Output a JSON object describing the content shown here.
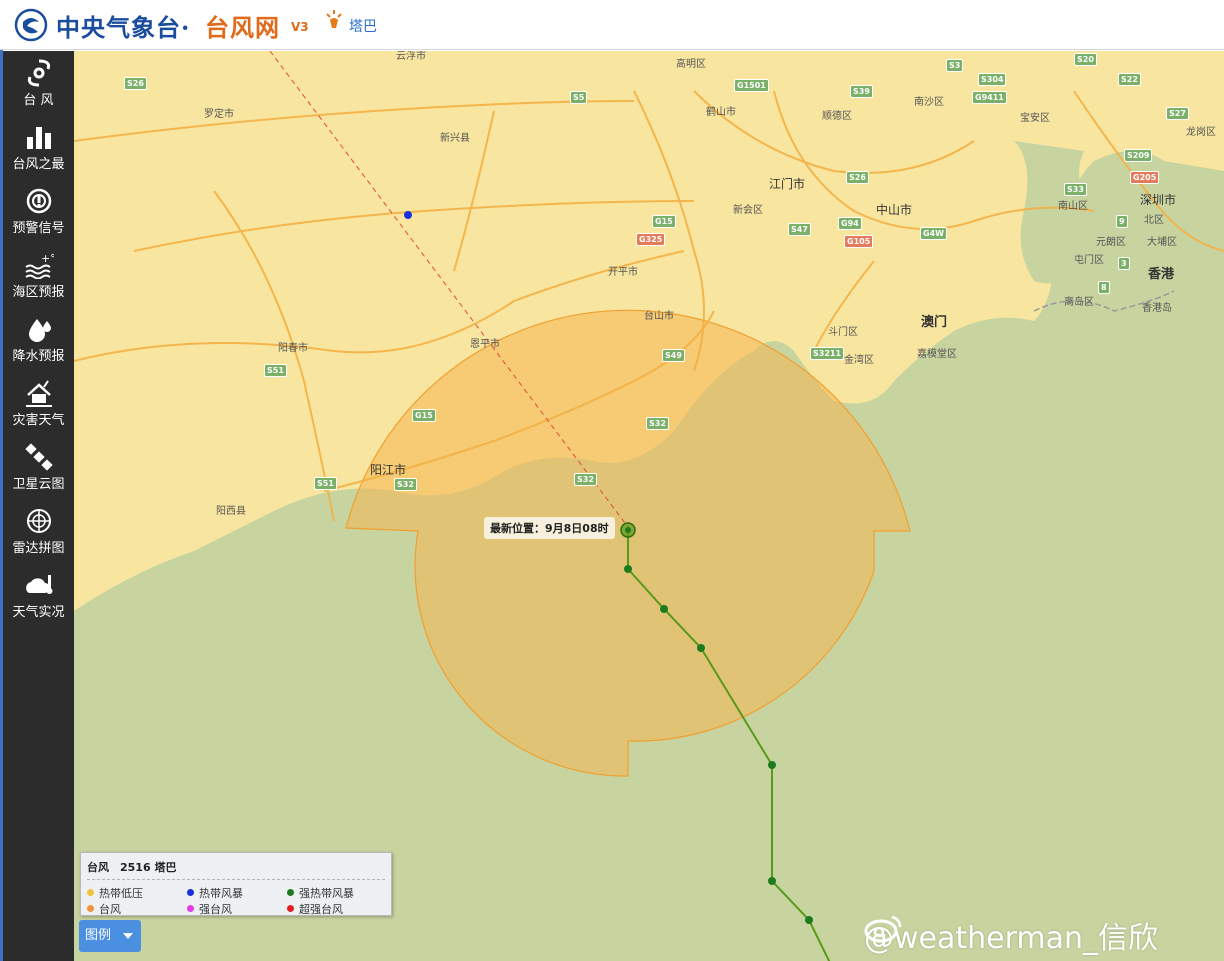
{
  "header": {
    "title_main": "中央气象台·",
    "title_site": "台风网",
    "version": "V3",
    "storm_name": "塔巴"
  },
  "sidebar": {
    "items": [
      {
        "label": "台 风",
        "icon": "typhoon-icon"
      },
      {
        "label": "台风之最",
        "icon": "bar-chart-icon"
      },
      {
        "label": "预警信号",
        "icon": "warning-signal-icon"
      },
      {
        "label": "海区预报",
        "icon": "sea-forecast-icon"
      },
      {
        "label": "降水预报",
        "icon": "rain-drop-icon"
      },
      {
        "label": "灾害天气",
        "icon": "disaster-house-icon"
      },
      {
        "label": "卫星云图",
        "icon": "satellite-icon"
      },
      {
        "label": "雷达拼图",
        "icon": "radar-icon"
      },
      {
        "label": "天气实况",
        "icon": "weather-cloud-icon"
      }
    ]
  },
  "map": {
    "places": [
      "云浮市",
      "罗定市",
      "新兴县",
      "高明区",
      "鹤山市",
      "顺德区",
      "南沙区",
      "宝安区",
      "龙岗区",
      "江门市",
      "新会区",
      "中山市",
      "南山区",
      "北区",
      "深圳市",
      "元朗区",
      "大埔区",
      "屯门区",
      "香港",
      "离岛区",
      "香港岛",
      "开平市",
      "台山市",
      "恩平市",
      "斗门区",
      "金湾区",
      "澳门",
      "嘉模堂区",
      "阳春市",
      "阳江市",
      "阳西县"
    ],
    "routes": [
      "S26",
      "S5",
      "G1501",
      "S39",
      "S3",
      "S304",
      "G9411",
      "S20",
      "S22",
      "S27",
      "S209",
      "G205",
      "S33",
      "S26",
      "G15",
      "G325",
      "S47",
      "G94",
      "G105",
      "G4W",
      "S49",
      "S3211",
      "S32",
      "G15",
      "S51",
      "S32",
      "S51",
      "S32",
      "9",
      "3",
      "8"
    ],
    "latest_position": "最新位置：9月8日08时"
  },
  "legend": {
    "title": "台风　2516 塔巴",
    "entries": [
      {
        "label": "热带低压",
        "color": "#f0c43a"
      },
      {
        "label": "热带风暴",
        "color": "#1a2fe0"
      },
      {
        "label": "强热带风暴",
        "color": "#1e7a1e"
      },
      {
        "label": "台风",
        "color": "#f0933a"
      },
      {
        "label": "强台风",
        "color": "#e83ae8"
      },
      {
        "label": "超强台风",
        "color": "#e02020"
      }
    ],
    "button_label": "图例"
  },
  "watermark": "@weatherman_信欣",
  "colors": {
    "land": "#f8e6a0",
    "sea": "#c8d4a0",
    "wind_circle": "#f4b450",
    "track": "#5a9a1a",
    "sidebar": "#2c2c2c"
  }
}
